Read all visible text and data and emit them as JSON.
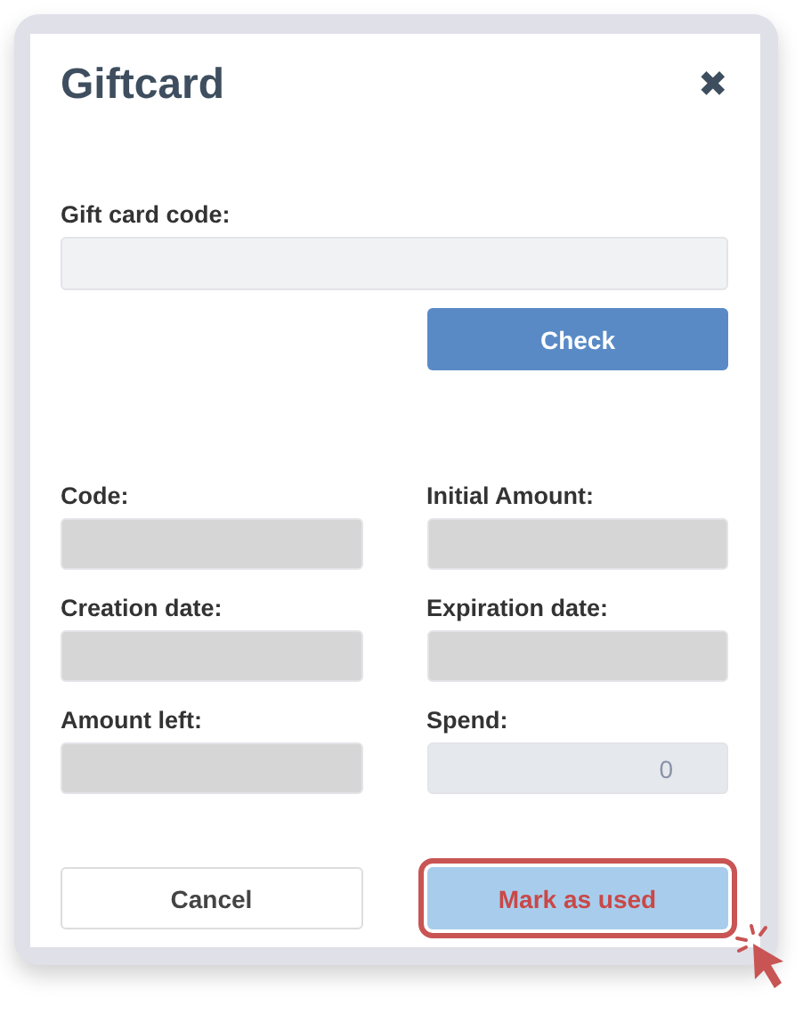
{
  "dialog": {
    "title": "Giftcard",
    "close_icon": "✖"
  },
  "code_field": {
    "label": "Gift card code:"
  },
  "check_button": "Check",
  "fields": [
    {
      "label": "Code:",
      "kind": "readonly"
    },
    {
      "label": "Initial Amount:",
      "kind": "readonly"
    },
    {
      "label": "Creation date:",
      "kind": "readonly"
    },
    {
      "label": "Expiration date:",
      "kind": "readonly"
    },
    {
      "label": "Amount left:",
      "kind": "readonly"
    },
    {
      "label": "Spend:",
      "kind": "input",
      "value": "0"
    }
  ],
  "buttons": [
    {
      "label": "Cancel",
      "kind": "secondary",
      "highlighted": false
    },
    {
      "label": "Mark as used",
      "kind": "primary",
      "highlighted": true
    }
  ]
}
